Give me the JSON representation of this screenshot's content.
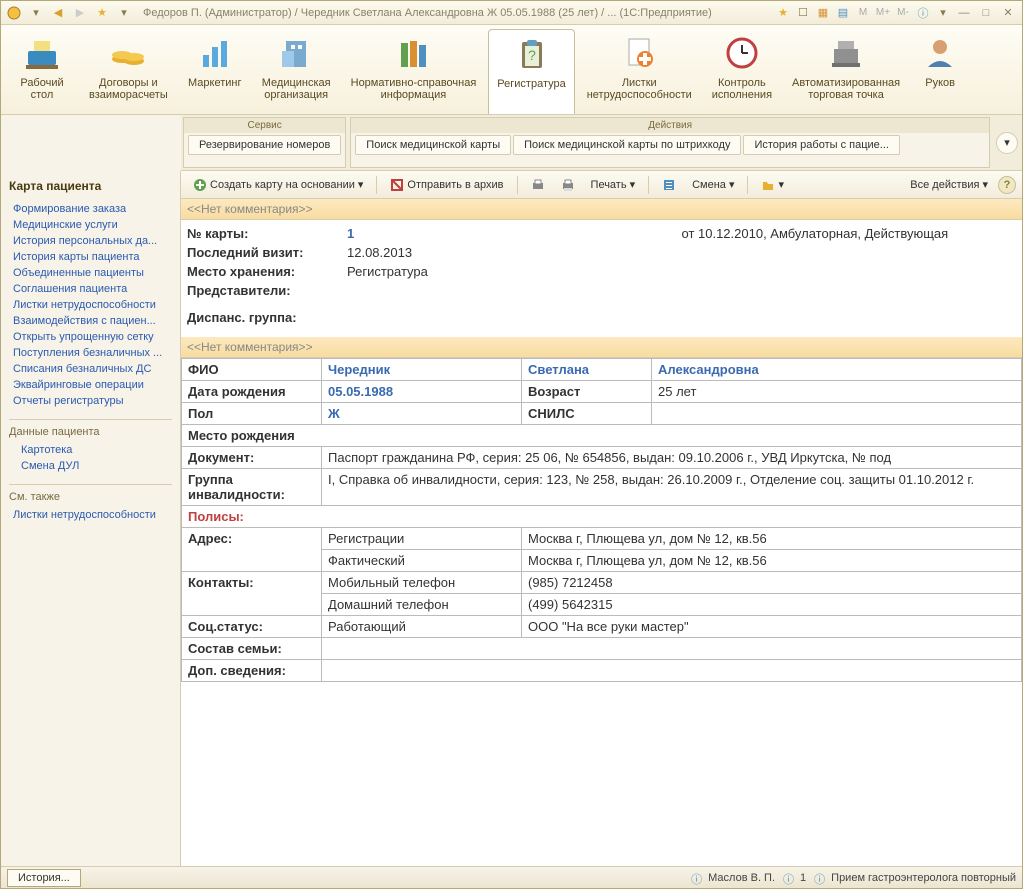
{
  "titlebar": {
    "title": "Федоров П. (Администратор) / Чередник Светлана Александровна Ж 05.05.1988 (25 лет) / ... (1С:Предприятие)",
    "m_btns": [
      "M",
      "M+",
      "M-"
    ]
  },
  "ribbon": {
    "items": [
      {
        "label": "Рабочий\nстол"
      },
      {
        "label": "Договоры и\nвзаиморасчеты"
      },
      {
        "label": "Маркетинг"
      },
      {
        "label": "Медицинская\nорганизация"
      },
      {
        "label": "Нормативно-справочная\nинформация"
      },
      {
        "label": "Регистратура",
        "active": true
      },
      {
        "label": "Листки\nнетрудоспособности"
      },
      {
        "label": "Контроль\nисполнения"
      },
      {
        "label": "Автоматизированная\nторговая точка"
      },
      {
        "label": "Руков"
      }
    ]
  },
  "subribbon": {
    "groups": [
      {
        "title": "Сервис",
        "buttons": [
          "Резервирование номеров"
        ]
      },
      {
        "title": "Действия",
        "buttons": [
          "Поиск медицинской карты",
          "Поиск медицинской карты по штрихкоду",
          "История работы с пацие..."
        ]
      }
    ]
  },
  "sidebar": {
    "title": "Карта пациента",
    "links": [
      "Формирование заказа",
      "Медицинские услуги",
      "История персональных да...",
      "История карты пациента",
      "Объединенные пациенты",
      "Соглашения пациента",
      "Листки нетрудоспособности",
      "Взаимодействия с пациен...",
      "Открыть упрощенную сетку",
      "Поступления безналичных ...",
      "Списания безналичных ДС",
      "Эквайринговые операции",
      "Отчеты регистратуры"
    ],
    "section2_title": "Данные пациента",
    "section2_links": [
      "Картотека",
      "Смена ДУЛ"
    ],
    "section3_title": "См. также",
    "section3_links": [
      "Листки нетрудоспособности"
    ]
  },
  "toolbar": {
    "create": "Создать карту на основании",
    "archive": "Отправить в архив",
    "print": "Печать",
    "shift": "Смена",
    "all_actions": "Все действия"
  },
  "card": {
    "no_comment": "<<Нет комментария>>",
    "card_no_label": "№ карты:",
    "card_no": "1",
    "card_info": "от 10.12.2010, Амбулаторная, Действующая",
    "last_visit_label": "Последний визит:",
    "last_visit": "12.08.2013",
    "storage_label": "Место хранения:",
    "storage": "Регистратура",
    "reps_label": "Представители:",
    "disp_label": "Диспанс. группа:"
  },
  "patient": {
    "fio_label": "ФИО",
    "surname": "Чередник",
    "name": "Светлана",
    "patronymic": "Александровна",
    "dob_label": "Дата рождения",
    "dob": "05.05.1988",
    "age_label": "Возраст",
    "age": "25 лет",
    "sex_label": "Пол",
    "sex": "Ж",
    "snils_label": "СНИЛС",
    "birthplace_label": "Место рождения",
    "doc_label": "Документ:",
    "doc": "Паспорт гражданина РФ, серия: 25 06, № 654856, выдан: 09.10.2006 г., УВД Иркутска, № под",
    "disability_label": "Группа инвалидности:",
    "disability": "I, Справка об инвалидности, серия: 123, № 258, выдан: 26.10.2009 г., Отделение соц. защиты 01.10.2012 г.",
    "policies_label": "Полисы:",
    "address_label": "Адрес:",
    "addr_reg_type": "Регистрации",
    "addr_reg": "Москва г, Плющева ул, дом № 12, кв.56",
    "addr_fact_type": "Фактический",
    "addr_fact": "Москва г, Плющева ул, дом № 12, кв.56",
    "contacts_label": "Контакты:",
    "mobile_type": "Мобильный телефон",
    "mobile": "(985) 7212458",
    "home_type": "Домашний телефон",
    "home": "(499) 5642315",
    "social_label": "Соц.статус:",
    "social_type": "Работающий",
    "social_val": "ООО \"На все руки мастер\"",
    "family_label": "Состав семьи:",
    "extra_label": "Доп. сведения:"
  },
  "statusbar": {
    "history": "История...",
    "user": "Маслов В. П.",
    "count": "1",
    "appointment": "Прием гастроэнтеролога повторный"
  }
}
